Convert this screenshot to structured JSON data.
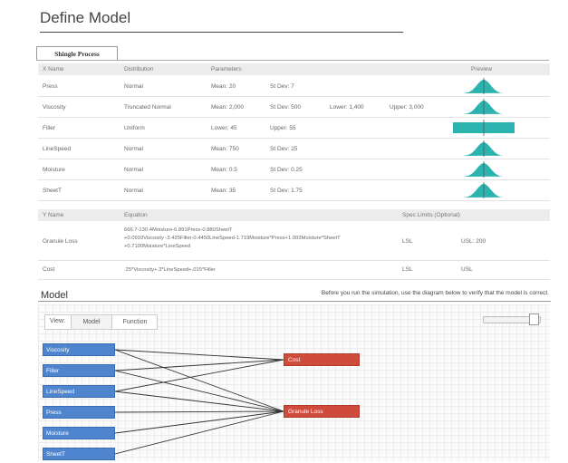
{
  "title": "Define Model",
  "tab_label": "Shingle Process",
  "x_table": {
    "headers": [
      "X Name",
      "Distribution",
      "Parameters",
      "Preview"
    ],
    "rows": [
      {
        "name": "Press",
        "dist": "Normal",
        "p1": "Mean: 20",
        "p2": "St Dev: 7",
        "p3": "",
        "p4": "",
        "preview": "normal"
      },
      {
        "name": "Viscosity",
        "dist": "Truncated Normal",
        "p1": "Mean: 2,000",
        "p2": "St Dev: 500",
        "p3": "Lower: 1,400",
        "p4": "Upper: 3,000",
        "preview": "normal"
      },
      {
        "name": "Filler",
        "dist": "Uniform",
        "p1": "Lower: 45",
        "p2": "Upper: 55",
        "p3": "",
        "p4": "",
        "preview": "uniform"
      },
      {
        "name": "LineSpeed",
        "dist": "Normal",
        "p1": "Mean: 750",
        "p2": "St Dev: 25",
        "p3": "",
        "p4": "",
        "preview": "normal"
      },
      {
        "name": "Moisture",
        "dist": "Normal",
        "p1": "Mean: 0.5",
        "p2": "St Dev: 0.25",
        "p3": "",
        "p4": "",
        "preview": "normal"
      },
      {
        "name": "SheetT",
        "dist": "Normal",
        "p1": "Mean: 35",
        "p2": "St Dev: 1.75",
        "p3": "",
        "p4": "",
        "preview": "normal"
      }
    ]
  },
  "y_table": {
    "headers": [
      "Y Name",
      "Equation",
      "Spec Limits (Optional)"
    ],
    "rows": [
      {
        "name": "Granule Loss",
        "eq": [
          "666.7-130.4Moisture-6.891Press-0.880SheetT",
          "+0.0910Viscosity -3.425Filler-0.4450LineSpeed-1.719Moisture*Press+1.003Moisture*SheetT",
          "+0.7100Moisture*LineSpeed"
        ],
        "lsl": "LSL",
        "usl": "USL: 200"
      },
      {
        "name": "Cost",
        "eq": [
          ".25*Viscosity+.3*LineSpeed+.015*Filler"
        ],
        "lsl": "LSL",
        "usl": "USL"
      }
    ]
  },
  "model": {
    "title": "Model",
    "note": "Before you run the simulation, use the diagram below to verify that the model is correct.",
    "view_label": "View:",
    "view_options": [
      "Model",
      "Function"
    ],
    "inputs": [
      "Viscosity",
      "Filler",
      "LineSpeed",
      "Press",
      "Moisture",
      "SheetT"
    ],
    "outputs": [
      "Cost",
      "Granule Loss"
    ],
    "links": [
      [
        "Viscosity",
        "Cost"
      ],
      [
        "Filler",
        "Cost"
      ],
      [
        "LineSpeed",
        "Cost"
      ],
      [
        "Viscosity",
        "Granule Loss"
      ],
      [
        "Filler",
        "Granule Loss"
      ],
      [
        "LineSpeed",
        "Granule Loss"
      ],
      [
        "Press",
        "Granule Loss"
      ],
      [
        "Moisture",
        "Granule Loss"
      ],
      [
        "SheetT",
        "Granule Loss"
      ]
    ]
  },
  "colors": {
    "preview": "#2bb3b0",
    "input_node": "#4f84cf",
    "output_node": "#cf4b3c"
  }
}
